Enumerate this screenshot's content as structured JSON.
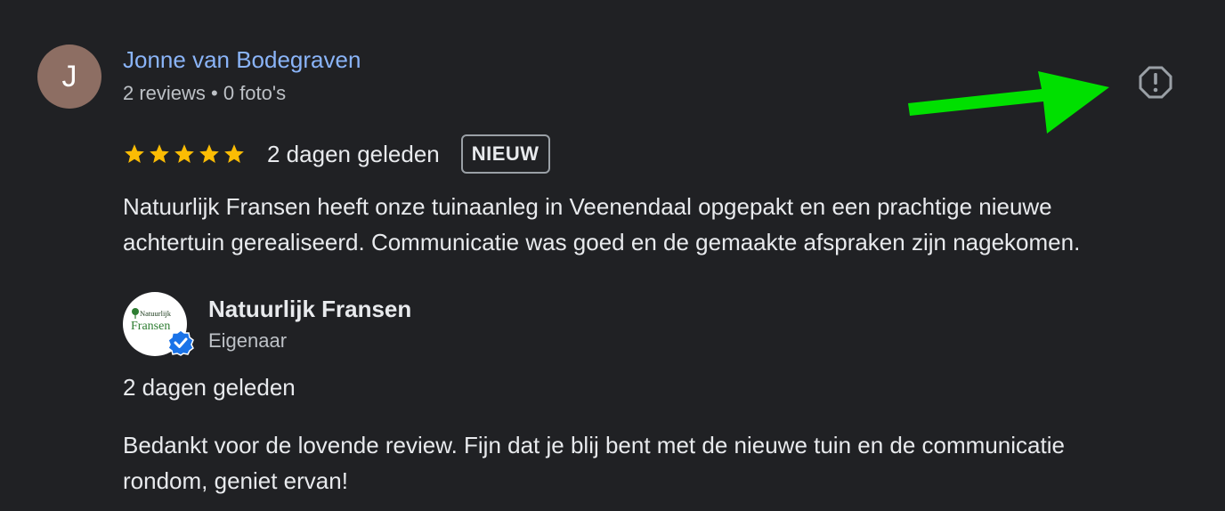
{
  "review": {
    "author_initial": "J",
    "author_name": "Jonne van Bodegraven",
    "author_meta": "2 reviews • 0 foto's",
    "rating": 5,
    "date": "2 dagen geleden",
    "badge": "NIEUW",
    "text_lines": [
      "Natuurlijk Fransen heeft onze tuinaanleg in Veenendaal opgepakt en een prachtige nieuwe",
      "achtertuin gerealiseerd. Communicatie was goed en de gemaakte afspraken zijn nagekomen."
    ]
  },
  "owner_reply": {
    "name": "Natuurlijk Fransen",
    "role": "Eigenaar",
    "logo_text_top": "Natuurlijk",
    "logo_text_bottom": "Fransen",
    "date": "2 dagen geleden",
    "text_lines": [
      "Bedankt voor de lovende review. Fijn dat je blij bent met de nieuwe tuin en de communicatie",
      "rondom, geniet ervan!"
    ]
  },
  "icons": {
    "report": "report-icon",
    "star": "star-icon",
    "verified": "verified-badge-icon",
    "annotation": "green-arrow-annotation"
  },
  "colors": {
    "background": "#202124",
    "author_link": "#8ab4f8",
    "star": "#fbbc04",
    "verified": "#1a73e8",
    "arrow": "#00e000",
    "avatar": "#8d6e63"
  }
}
